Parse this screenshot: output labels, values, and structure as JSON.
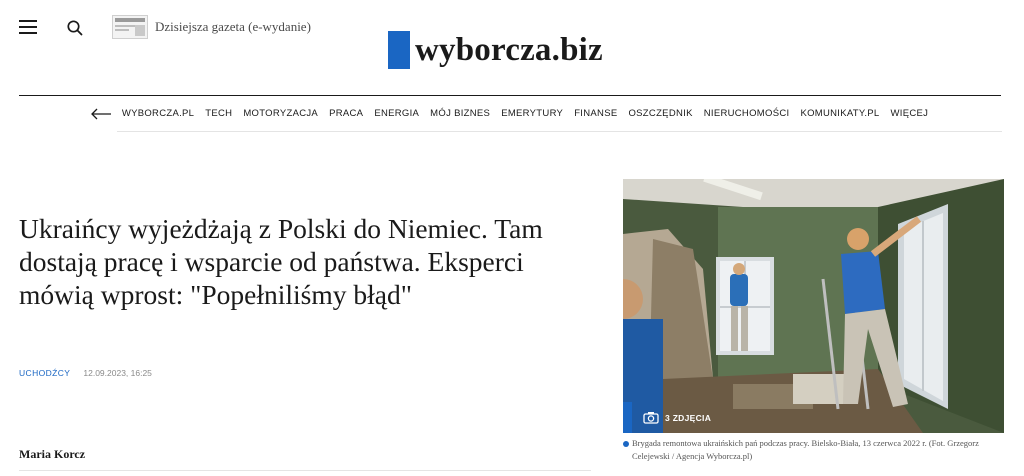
{
  "header": {
    "edition_label": "Dzisiejsza gazeta (e-wydanie)",
    "logo_text": "wyborcza.biz",
    "brand_color": "#1a66c3",
    "icons": [
      "menu-icon",
      "search-icon",
      "newspaper-thumbnail"
    ]
  },
  "nav": {
    "back_icon": "arrow-left-icon",
    "items": [
      "WYBORCZA.PL",
      "TECH",
      "MOTORYZACJA",
      "PRACA",
      "ENERGIA",
      "MÓJ BIZNES",
      "EMERYTURY",
      "FINANSE",
      "OSZCZĘDNIK",
      "NIERUCHOMOŚCI",
      "KOMUNIKATY.PL",
      "WIĘCEJ"
    ]
  },
  "article": {
    "headline": "Ukraińcy wyjeżdżają z Polski do Niemiec. Tam dostają pracę i wsparcie od państwa. Eksperci mówią wprost: \"Popełniliśmy błąd\"",
    "category": "UCHODŹCY",
    "date": "12.09.2023, 16:25",
    "author": "Maria Korcz"
  },
  "photo": {
    "gallery_icon": "camera-icon",
    "gallery_label": "3 ZDJĘCIA",
    "caption": "Brygada remontowa ukraińskich pań podczas pracy. Bielsko-Biała, 13 czerwca 2022 r. (Fot. Grzegorz Celejewski / Agencja Wyborcza.pl)"
  }
}
